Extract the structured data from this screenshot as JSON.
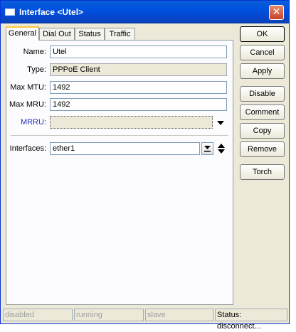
{
  "window": {
    "title": "Interface <Utel>",
    "close_label": "✕"
  },
  "tabs": [
    {
      "label": "General"
    },
    {
      "label": "Dial Out"
    },
    {
      "label": "Status"
    },
    {
      "label": "Traffic"
    }
  ],
  "form": {
    "name": {
      "label": "Name:",
      "value": "Utel"
    },
    "type": {
      "label": "Type:",
      "value": "PPPoE Client"
    },
    "max_mtu": {
      "label": "Max MTU:",
      "value": "1492"
    },
    "max_mru": {
      "label": "Max MRU:",
      "value": "1492"
    },
    "mrru": {
      "label": "MRRU:",
      "value": "",
      "label_color": "#2030c0"
    },
    "interfaces": {
      "label": "Interfaces:",
      "value": "ether1"
    }
  },
  "buttons": {
    "ok": "OK",
    "cancel": "Cancel",
    "apply": "Apply",
    "disable": "Disable",
    "comment": "Comment",
    "copy": "Copy",
    "remove": "Remove",
    "torch": "Torch"
  },
  "statusbar": {
    "disabled": "disabled",
    "running": "running",
    "slave": "slave",
    "status": "Status: disconnect..."
  }
}
